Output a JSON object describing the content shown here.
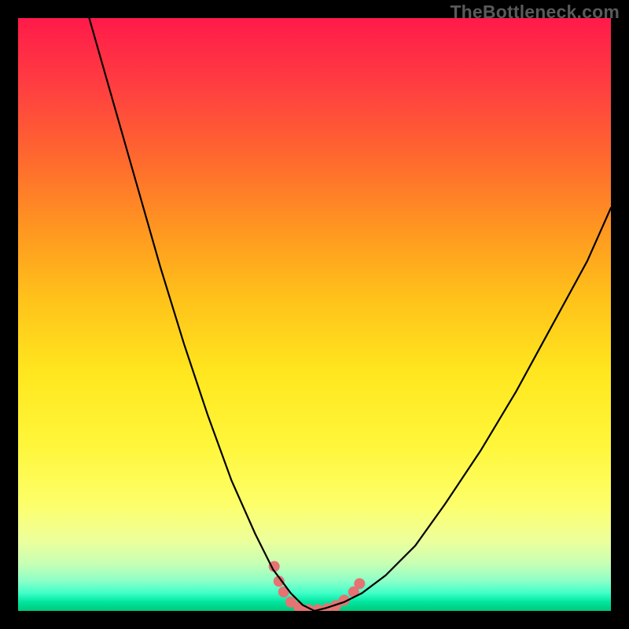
{
  "watermark": "TheBottleneck.com",
  "chart_data": {
    "type": "line",
    "title": "",
    "xlabel": "",
    "ylabel": "",
    "xlim": [
      0,
      100
    ],
    "ylim": [
      0,
      100
    ],
    "grid": false,
    "legend": false,
    "series": [
      {
        "name": "bottleneck-curve-left",
        "x": [
          12,
          16,
          20,
          24,
          28,
          32,
          36,
          40,
          43,
          46,
          48,
          50
        ],
        "y": [
          100,
          86,
          72,
          58,
          45,
          33,
          22,
          13,
          7,
          3,
          1,
          0
        ]
      },
      {
        "name": "bottleneck-curve-right",
        "x": [
          50,
          52,
          55,
          58,
          62,
          67,
          72,
          78,
          84,
          90,
          96,
          100
        ],
        "y": [
          0,
          0.5,
          1.5,
          3,
          6,
          11,
          18,
          27,
          37,
          48,
          59,
          68
        ]
      }
    ],
    "highlight_points": [
      {
        "x": 43.2,
        "y": 7.5
      },
      {
        "x": 44.0,
        "y": 5.0
      },
      {
        "x": 44.8,
        "y": 3.2
      },
      {
        "x": 46.0,
        "y": 1.5
      },
      {
        "x": 47.4,
        "y": 0.6
      },
      {
        "x": 49.0,
        "y": 0.2
      },
      {
        "x": 50.6,
        "y": 0.2
      },
      {
        "x": 52.2,
        "y": 0.4
      },
      {
        "x": 53.6,
        "y": 0.9
      },
      {
        "x": 55.0,
        "y": 1.8
      },
      {
        "x": 56.6,
        "y": 3.2
      },
      {
        "x": 57.6,
        "y": 4.6
      }
    ]
  }
}
